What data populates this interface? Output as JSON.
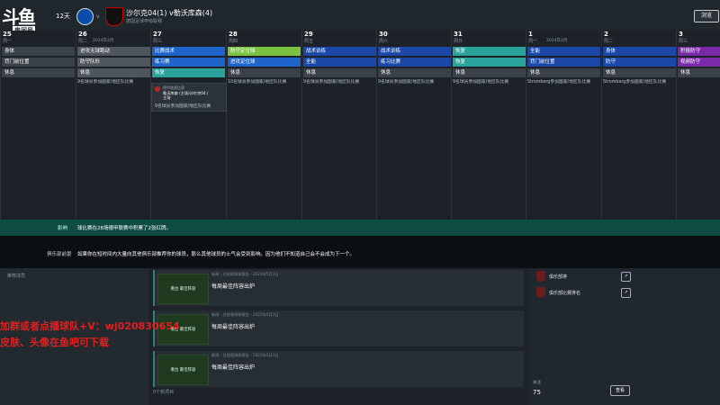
{
  "stream": {
    "logo_text": "斗鱼",
    "room_badge": "房间号",
    "room_number": "10710570"
  },
  "match": {
    "days_label": "12天",
    "vs": "v",
    "title": "沙尔克04(1) v勒沃库森(4)",
    "subtitle": "德国足球甲级联赛",
    "browse_button": "浏览"
  },
  "calendar": {
    "days": [
      {
        "num": "25",
        "wd": "周一",
        "slots": [
          {
            "label": "身体",
            "color": "#3b4148"
          },
          {
            "label": "罚门前位置",
            "color": "#3b4148"
          },
          {
            "label": "休息",
            "color": "#3b4148"
          }
        ],
        "event": ""
      },
      {
        "num": "26",
        "wd": "周二",
        "month": "2024年4月",
        "slots": [
          {
            "label": "进攻无球跑动",
            "color": "#4f565d"
          },
          {
            "label": "防守队形",
            "color": "#4f565d"
          },
          {
            "label": "休息",
            "color": "#4f565d"
          }
        ],
        "event": "9名球员参加国家/地区队比赛"
      },
      {
        "num": "27",
        "wd": "周三",
        "slots": [
          {
            "label": "比赛战术",
            "color": "#1f64c9"
          },
          {
            "label": "练习赛",
            "color": "#1f64c9"
          },
          {
            "label": "恢复",
            "color": "#2aa39c"
          }
        ],
        "event": ""
      },
      {
        "num": "28",
        "wd": "周四",
        "slots": [
          {
            "label": "防守定位球",
            "color": "#7cc242"
          },
          {
            "label": "进攻定位球",
            "color": "#1f64c9"
          },
          {
            "label": "休息",
            "color": "#3b4148"
          }
        ],
        "event": "10名球员参加国家/地区队比赛"
      },
      {
        "num": "29",
        "wd": "周五",
        "slots": [
          {
            "label": "战术训练",
            "color": "#1a47a8"
          },
          {
            "label": "全能",
            "color": "#1a47a8"
          },
          {
            "label": "休息",
            "color": "#3b4148"
          }
        ],
        "event": "9名球员参加国家/地区队比赛"
      },
      {
        "num": "30",
        "wd": "周六",
        "slots": [
          {
            "label": "战术训练",
            "color": "#1a47a8"
          },
          {
            "label": "练习比赛",
            "color": "#1a47a8"
          },
          {
            "label": "休息",
            "color": "#3b4148"
          }
        ],
        "event": "9名球员参加国家/地区队比赛"
      },
      {
        "num": "31",
        "wd": "周日",
        "slots": [
          {
            "label": "恢复",
            "color": "#2aa39c"
          },
          {
            "label": "恢复",
            "color": "#2aa39c"
          },
          {
            "label": "休息",
            "color": "#3b4148"
          }
        ],
        "event": "9名球员参加国家/地区队比赛"
      },
      {
        "num": "1",
        "wd": "周一",
        "month": "2024年4月",
        "slots": [
          {
            "label": "全能",
            "color": "#1a47a8"
          },
          {
            "label": "罚门前位置",
            "color": "#1a47a8"
          },
          {
            "label": "休息",
            "color": "#3b4148"
          }
        ],
        "event": "Stromberg参加国家/地区队比赛"
      },
      {
        "num": "2",
        "wd": "周二",
        "slots": [
          {
            "label": "身体",
            "color": "#1a47a8"
          },
          {
            "label": "防守",
            "color": "#1a47a8"
          },
          {
            "label": "休息",
            "color": "#3b4148"
          }
        ],
        "event": "Stromberg参加国家/地区队比赛"
      },
      {
        "num": "3",
        "wd": "周三",
        "slots": [
          {
            "label": "积极防守",
            "color": "#7a2aa8"
          },
          {
            "label": "视频防守",
            "color": "#7a2aa8"
          },
          {
            "label": "休息",
            "color": "#3b4148"
          }
        ],
        "event": ""
      }
    ],
    "popup": {
      "line1": "德甲联赛比赛",
      "line2": "勒沃库森 (主场)沙尔克04 (",
      "line3": "主场",
      "line4": "9名球员参加国家/地区队比赛"
    }
  },
  "info_green": {
    "label": "影响",
    "text": "球比赛在28场德甲联赛中积累了2张红牌。"
  },
  "info_dark": {
    "label": "俱乐部前景",
    "text": "如果你在短时间内大量向其他俱乐部推荐你的球员，那么其他球员的士气会受到影响。因为他们不知道自己会不会成为下一个。"
  },
  "scouting": {
    "header": "推荐球员",
    "footer": "0个新项目"
  },
  "cards": [
    {
      "thumb": "看台\n最佳阵容",
      "meta": "新闻 - 总经理球探报告 - 2023年5月3日",
      "title": "每周最佳阵容出炉"
    },
    {
      "thumb": "看台\n最佳阵容",
      "meta": "新闻 - 总经理球探报告 - 2023年5月3日",
      "title": "每周最佳阵容出炉"
    },
    {
      "thumb": "看台\n最佳阵容",
      "meta": "新闻 - 总经理球探报告 - 2023年5月3日",
      "title": "每周最佳阵容出炉"
    }
  ],
  "right_panel": {
    "items": [
      {
        "label": "俱乐部排"
      },
      {
        "label": "俱乐部比赛排名"
      }
    ],
    "price_label": "关注",
    "price_value": "75",
    "action_button": "查看"
  },
  "overlay": {
    "line1": "加群或者点播球队+V：wj020830654",
    "line2": "皮肤、头像在鱼吧可下载"
  }
}
